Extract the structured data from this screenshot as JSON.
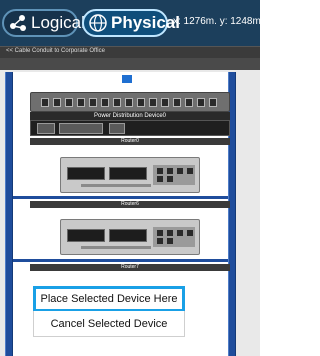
{
  "header": {
    "tabs": [
      {
        "label": "Logical",
        "icon": "network-nodes-icon",
        "active": false
      },
      {
        "label": "Physical",
        "icon": "globe-icon",
        "active": true
      }
    ],
    "coordinates": "x: 1276m. y: 1248m"
  },
  "breadcrumb": {
    "text": "<< Cable Conduit to Corporate Office"
  },
  "rack": {
    "slot_marker": "",
    "devices": [
      {
        "name": "Power Distribution Device0"
      },
      {
        "name": "Router0"
      },
      {
        "name": "Router6"
      },
      {
        "name": "Router7"
      }
    ]
  },
  "context_menu": {
    "place_label": "Place Selected Device Here",
    "cancel_label": "Cancel Selected Device"
  },
  "colors": {
    "toolbar": "#1c3f5c",
    "rail": "#1f4d9c",
    "highlight": "#19a0e6"
  }
}
